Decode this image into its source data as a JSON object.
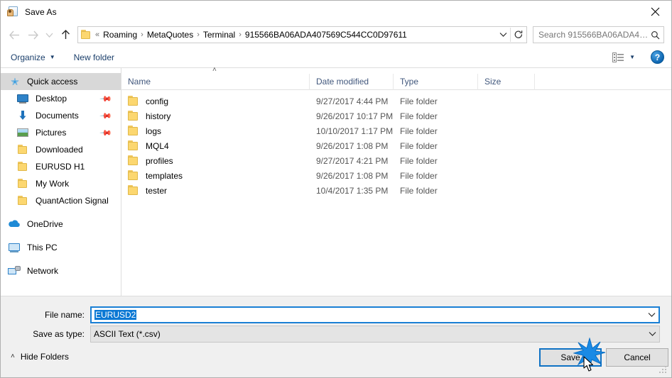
{
  "window": {
    "title": "Save As",
    "icon": "save-as-icon",
    "close_label": "✕"
  },
  "nav": {
    "back_icon": "back-arrow-icon",
    "forward_icon": "forward-arrow-icon",
    "recent_icon": "recent-locations-chevron-icon",
    "up_icon": "up-arrow-icon",
    "refresh_icon": "refresh-icon",
    "address_chevron_icon": "chevron-down-icon",
    "folder_icon": "folder-icon",
    "breadcrumb_prefix": "«",
    "breadcrumbs": [
      "Roaming",
      "MetaQuotes",
      "Terminal",
      "915566BA06ADA407569C544CC0D97611"
    ],
    "separator": "›"
  },
  "search": {
    "placeholder": "Search 915566BA06ADA40756...",
    "icon": "search-icon"
  },
  "commandbar": {
    "organize_label": "Organize",
    "organize_caret": "▼",
    "new_folder_label": "New folder",
    "view_icon": "view-layout-icon",
    "view_caret": "▼",
    "help_label": "?",
    "help_icon": "help-icon"
  },
  "sidebar": {
    "items": [
      {
        "label": "Quick access",
        "icon": "star-icon",
        "level": 0,
        "selected": true,
        "pinned": false
      },
      {
        "label": "Desktop",
        "icon": "desktop-icon",
        "level": 1,
        "selected": false,
        "pinned": true
      },
      {
        "label": "Documents",
        "icon": "documents-icon",
        "level": 1,
        "selected": false,
        "pinned": true
      },
      {
        "label": "Pictures",
        "icon": "pictures-icon",
        "level": 1,
        "selected": false,
        "pinned": true
      },
      {
        "label": "Downloaded",
        "icon": "folder-icon",
        "level": 1,
        "selected": false,
        "pinned": false
      },
      {
        "label": "EURUSD H1",
        "icon": "folder-icon",
        "level": 1,
        "selected": false,
        "pinned": false
      },
      {
        "label": "My Work",
        "icon": "folder-icon",
        "level": 1,
        "selected": false,
        "pinned": false
      },
      {
        "label": "QuantAction Signal",
        "icon": "folder-icon",
        "level": 1,
        "selected": false,
        "pinned": false
      },
      {
        "label": "OneDrive",
        "icon": "onedrive-icon",
        "level": 0,
        "selected": false,
        "pinned": false,
        "gap_before": true
      },
      {
        "label": "This PC",
        "icon": "this-pc-icon",
        "level": 0,
        "selected": false,
        "pinned": false,
        "gap_before": true
      },
      {
        "label": "Network",
        "icon": "network-icon",
        "level": 0,
        "selected": false,
        "pinned": false,
        "gap_before": true
      }
    ]
  },
  "filelist": {
    "sort_indicator": "˄",
    "columns": [
      "Name",
      "Date modified",
      "Type",
      "Size"
    ],
    "rows": [
      {
        "name": "config",
        "date": "9/27/2017 4:44 PM",
        "type": "File folder",
        "size": ""
      },
      {
        "name": "history",
        "date": "9/26/2017 10:17 PM",
        "type": "File folder",
        "size": ""
      },
      {
        "name": "logs",
        "date": "10/10/2017 1:17 PM",
        "type": "File folder",
        "size": ""
      },
      {
        "name": "MQL4",
        "date": "9/26/2017 1:08 PM",
        "type": "File folder",
        "size": ""
      },
      {
        "name": "profiles",
        "date": "9/27/2017 4:21 PM",
        "type": "File folder",
        "size": ""
      },
      {
        "name": "templates",
        "date": "9/26/2017 1:08 PM",
        "type": "File folder",
        "size": ""
      },
      {
        "name": "tester",
        "date": "10/4/2017 1:35 PM",
        "type": "File folder",
        "size": ""
      }
    ]
  },
  "footer": {
    "filename_label": "File name:",
    "filename_value": "EURUSD2",
    "filetype_label": "Save as type:",
    "filetype_value": "ASCII Text (*.csv)",
    "dropdown_icon": "chevron-down-icon",
    "hide_folders_label": "Hide Folders",
    "hide_folders_chevron": "˄",
    "save_label": "Save",
    "cancel_label": "Cancel",
    "cursor_icon": "mouse-cursor-icon",
    "click_burst_icon": "click-burst-icon",
    "resize_grip_icon": "resize-grip-icon"
  },
  "colors": {
    "accent": "#0078d7",
    "selection": "#0a78d4",
    "focus_border": "#0f72c4",
    "folder_yellow": "#fcd770",
    "header_text": "#41577c",
    "sidebar_selected": "#d8d8d8"
  }
}
